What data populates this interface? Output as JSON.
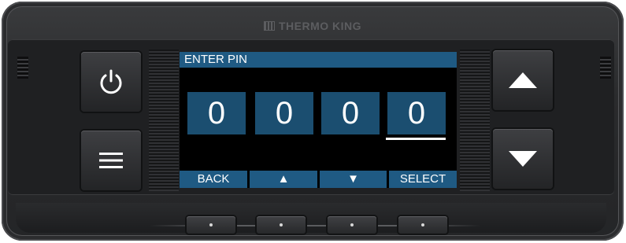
{
  "brand": {
    "name": "THERMO KING"
  },
  "screen": {
    "title": "ENTER PIN",
    "pin_digits": [
      "0",
      "0",
      "0",
      "0"
    ],
    "active_digit_index": 3,
    "softkeys": [
      {
        "label": "BACK"
      },
      {
        "label": "▲"
      },
      {
        "label": "▼"
      },
      {
        "label": "SELECT"
      }
    ]
  },
  "colors": {
    "accent_bar": "#1f5a83",
    "digit_box": "#1b4e70",
    "screen_bg": "#000000",
    "housing": "#2a2b2d"
  },
  "keys": {
    "left": [
      "power-icon",
      "menu-icon"
    ],
    "right": [
      "arrow-up-icon",
      "arrow-down-icon"
    ]
  }
}
